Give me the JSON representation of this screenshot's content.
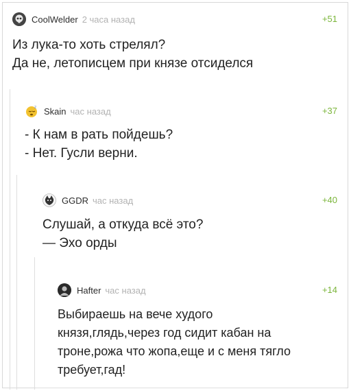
{
  "comments": [
    {
      "nick": "CoolWelder",
      "time": "2 часа назад",
      "rating": "+51",
      "lines": [
        "Из лука-то хоть стрелял?",
        "Да не, летописцем при князе отсиделся"
      ],
      "avatar_icon": "skull-avatar-icon"
    },
    {
      "nick": "Skain",
      "time": "час назад",
      "rating": "+37",
      "lines": [
        "- К нам в рать пойдешь?",
        "- Нет. Гусли верни."
      ],
      "avatar_icon": "sleepy-face-avatar-icon"
    },
    {
      "nick": "GGDR",
      "time": "час назад",
      "rating": "+40",
      "lines": [
        "Слушай, а откуда всё это?",
        "— Эхо орды"
      ],
      "avatar_icon": "animal-avatar-icon"
    },
    {
      "nick": "Hafter",
      "time": "час назад",
      "rating": "+14",
      "lines": [
        "Выбираешь на вече худого",
        "князя,глядь,через год сидит кабан на",
        "троне,рожа что жопа,еще и с меня тягло",
        "требует,гад!"
      ],
      "avatar_icon": "person-avatar-icon"
    }
  ],
  "colors": {
    "rating": "#7bb53a",
    "time": "#b2b2b2",
    "branch": "#dedede"
  }
}
